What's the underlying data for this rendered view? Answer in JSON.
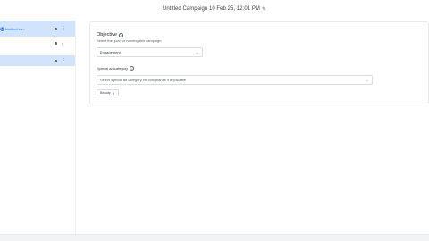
{
  "header": {
    "title": "Untitled Campaign 10 Feb 25, 12:01 PM",
    "edit_icon": "pencil-icon"
  },
  "sidebar": {
    "items": [
      {
        "label": "Ⓜ️ Untitled ca..."
      },
      {
        "label": ""
      },
      {
        "label": ""
      }
    ]
  },
  "objective": {
    "title": "Objective",
    "subtitle": "Select the goal for running this campaign",
    "selected": "Engagement"
  },
  "special_category": {
    "label": "Special ad category",
    "placeholder": "Select special ad category for compliance if applicable",
    "chips": [
      {
        "label": "Beauty"
      }
    ]
  },
  "colors": {
    "accent": "#1a73e8",
    "selected_bg": "#d2e3fc",
    "border": "#dadce0"
  }
}
